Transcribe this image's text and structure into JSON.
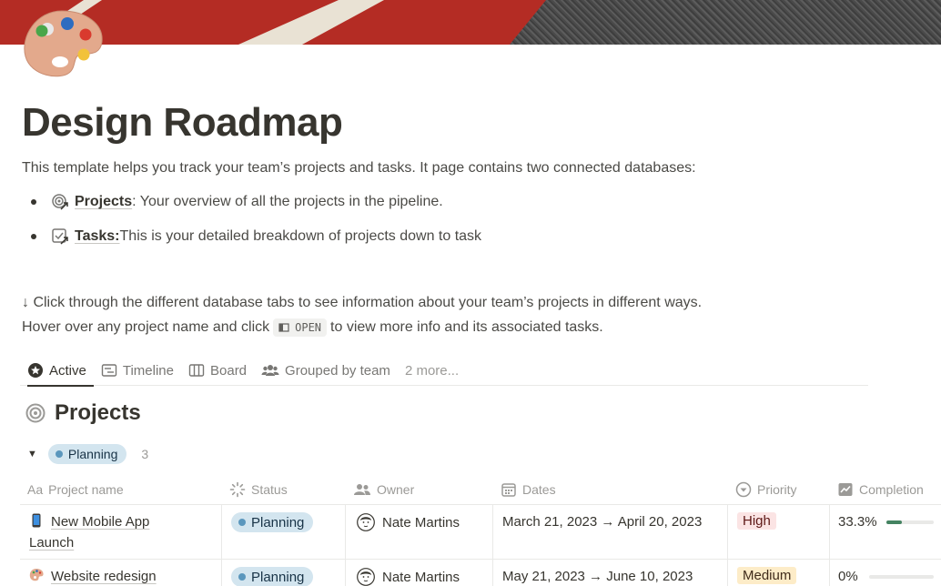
{
  "page": {
    "title": "Design Roadmap",
    "description": "This template helps you track your team’s projects and tasks. It page contains two connected databases:",
    "bullets": [
      {
        "link": "Projects",
        "text": ": Your overview of all the projects in the pipeline.",
        "icon": "target-link-icon"
      },
      {
        "link": "Tasks:",
        "text": " This is your detailed breakdown of projects down to task",
        "icon": "checkbox-link-icon"
      }
    ],
    "info_line1": "↓ Click through the different database tabs to see information about your team’s projects in different ways.",
    "info_line2_before": "Hover over any project name and click",
    "open_chip": "OPEN",
    "info_line2_after": "to view more info and its associated tasks."
  },
  "tabs": [
    {
      "label": "Active",
      "icon": "star-badge-icon",
      "active": true
    },
    {
      "label": "Timeline",
      "icon": "timeline-icon"
    },
    {
      "label": "Board",
      "icon": "board-icon"
    },
    {
      "label": "Grouped by team",
      "icon": "people-icon"
    },
    {
      "label": "2 more..."
    }
  ],
  "database": {
    "title": "Projects",
    "group": {
      "label": "Planning",
      "count": "3"
    },
    "columns": [
      "Project name",
      "Status",
      "Owner",
      "Dates",
      "Priority",
      "Completion"
    ],
    "column_icons": {
      "Project name": "Aa",
      "Status": "status-icon",
      "Owner": "people-icon",
      "Dates": "calendar-icon",
      "Priority": "priority-icon",
      "Completion": "chart-icon"
    },
    "rows": [
      {
        "name_line1": "New Mobile App",
        "name_line2": "Launch",
        "emoji": "mobile-phone-icon",
        "status": "Planning",
        "owner": "Nate Martins",
        "dates": "March 21, 2023 → April 20, 2023",
        "priority": "High",
        "completion": "33.3%",
        "completion_fraction": 0.333
      },
      {
        "name_line1": "Website redesign",
        "name_line2": "",
        "emoji": "palette-icon",
        "status": "Planning",
        "owner": "Nate Martins",
        "dates": "May 21, 2023 → June 10, 2023",
        "priority": "Medium",
        "completion": "0%",
        "completion_fraction": 0
      }
    ]
  },
  "colors": {
    "planning_bg": "#d3e5ef",
    "planning_dot": "#5b97bd",
    "high_bg": "#fbe4e4",
    "medium_bg": "#fdecc8",
    "progress_fill": "#448361"
  }
}
